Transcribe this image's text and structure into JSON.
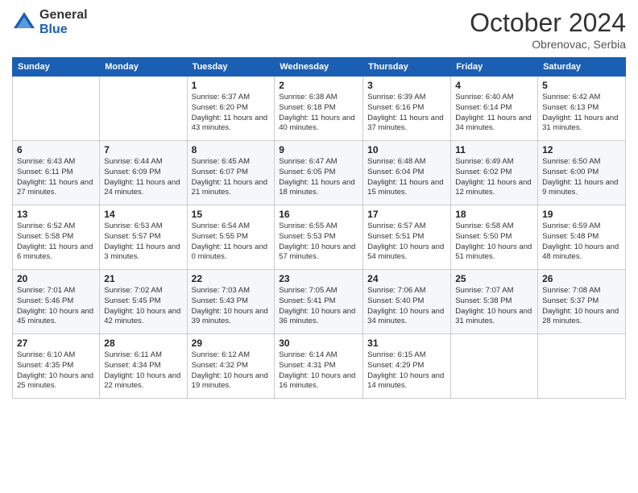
{
  "logo": {
    "general": "General",
    "blue": "Blue"
  },
  "header": {
    "month": "October 2024",
    "location": "Obrenovac, Serbia"
  },
  "weekdays": [
    "Sunday",
    "Monday",
    "Tuesday",
    "Wednesday",
    "Thursday",
    "Friday",
    "Saturday"
  ],
  "weeks": [
    [
      {
        "day": "",
        "info": ""
      },
      {
        "day": "",
        "info": ""
      },
      {
        "day": "1",
        "info": "Sunrise: 6:37 AM\nSunset: 6:20 PM\nDaylight: 11 hours and 43 minutes."
      },
      {
        "day": "2",
        "info": "Sunrise: 6:38 AM\nSunset: 6:18 PM\nDaylight: 11 hours and 40 minutes."
      },
      {
        "day": "3",
        "info": "Sunrise: 6:39 AM\nSunset: 6:16 PM\nDaylight: 11 hours and 37 minutes."
      },
      {
        "day": "4",
        "info": "Sunrise: 6:40 AM\nSunset: 6:14 PM\nDaylight: 11 hours and 34 minutes."
      },
      {
        "day": "5",
        "info": "Sunrise: 6:42 AM\nSunset: 6:13 PM\nDaylight: 11 hours and 31 minutes."
      }
    ],
    [
      {
        "day": "6",
        "info": "Sunrise: 6:43 AM\nSunset: 6:11 PM\nDaylight: 11 hours and 27 minutes."
      },
      {
        "day": "7",
        "info": "Sunrise: 6:44 AM\nSunset: 6:09 PM\nDaylight: 11 hours and 24 minutes."
      },
      {
        "day": "8",
        "info": "Sunrise: 6:45 AM\nSunset: 6:07 PM\nDaylight: 11 hours and 21 minutes."
      },
      {
        "day": "9",
        "info": "Sunrise: 6:47 AM\nSunset: 6:05 PM\nDaylight: 11 hours and 18 minutes."
      },
      {
        "day": "10",
        "info": "Sunrise: 6:48 AM\nSunset: 6:04 PM\nDaylight: 11 hours and 15 minutes."
      },
      {
        "day": "11",
        "info": "Sunrise: 6:49 AM\nSunset: 6:02 PM\nDaylight: 11 hours and 12 minutes."
      },
      {
        "day": "12",
        "info": "Sunrise: 6:50 AM\nSunset: 6:00 PM\nDaylight: 11 hours and 9 minutes."
      }
    ],
    [
      {
        "day": "13",
        "info": "Sunrise: 6:52 AM\nSunset: 5:58 PM\nDaylight: 11 hours and 6 minutes."
      },
      {
        "day": "14",
        "info": "Sunrise: 6:53 AM\nSunset: 5:57 PM\nDaylight: 11 hours and 3 minutes."
      },
      {
        "day": "15",
        "info": "Sunrise: 6:54 AM\nSunset: 5:55 PM\nDaylight: 11 hours and 0 minutes."
      },
      {
        "day": "16",
        "info": "Sunrise: 6:55 AM\nSunset: 5:53 PM\nDaylight: 10 hours and 57 minutes."
      },
      {
        "day": "17",
        "info": "Sunrise: 6:57 AM\nSunset: 5:51 PM\nDaylight: 10 hours and 54 minutes."
      },
      {
        "day": "18",
        "info": "Sunrise: 6:58 AM\nSunset: 5:50 PM\nDaylight: 10 hours and 51 minutes."
      },
      {
        "day": "19",
        "info": "Sunrise: 6:59 AM\nSunset: 5:48 PM\nDaylight: 10 hours and 48 minutes."
      }
    ],
    [
      {
        "day": "20",
        "info": "Sunrise: 7:01 AM\nSunset: 5:46 PM\nDaylight: 10 hours and 45 minutes."
      },
      {
        "day": "21",
        "info": "Sunrise: 7:02 AM\nSunset: 5:45 PM\nDaylight: 10 hours and 42 minutes."
      },
      {
        "day": "22",
        "info": "Sunrise: 7:03 AM\nSunset: 5:43 PM\nDaylight: 10 hours and 39 minutes."
      },
      {
        "day": "23",
        "info": "Sunrise: 7:05 AM\nSunset: 5:41 PM\nDaylight: 10 hours and 36 minutes."
      },
      {
        "day": "24",
        "info": "Sunrise: 7:06 AM\nSunset: 5:40 PM\nDaylight: 10 hours and 34 minutes."
      },
      {
        "day": "25",
        "info": "Sunrise: 7:07 AM\nSunset: 5:38 PM\nDaylight: 10 hours and 31 minutes."
      },
      {
        "day": "26",
        "info": "Sunrise: 7:08 AM\nSunset: 5:37 PM\nDaylight: 10 hours and 28 minutes."
      }
    ],
    [
      {
        "day": "27",
        "info": "Sunrise: 6:10 AM\nSunset: 4:35 PM\nDaylight: 10 hours and 25 minutes."
      },
      {
        "day": "28",
        "info": "Sunrise: 6:11 AM\nSunset: 4:34 PM\nDaylight: 10 hours and 22 minutes."
      },
      {
        "day": "29",
        "info": "Sunrise: 6:12 AM\nSunset: 4:32 PM\nDaylight: 10 hours and 19 minutes."
      },
      {
        "day": "30",
        "info": "Sunrise: 6:14 AM\nSunset: 4:31 PM\nDaylight: 10 hours and 16 minutes."
      },
      {
        "day": "31",
        "info": "Sunrise: 6:15 AM\nSunset: 4:29 PM\nDaylight: 10 hours and 14 minutes."
      },
      {
        "day": "",
        "info": ""
      },
      {
        "day": "",
        "info": ""
      }
    ]
  ]
}
